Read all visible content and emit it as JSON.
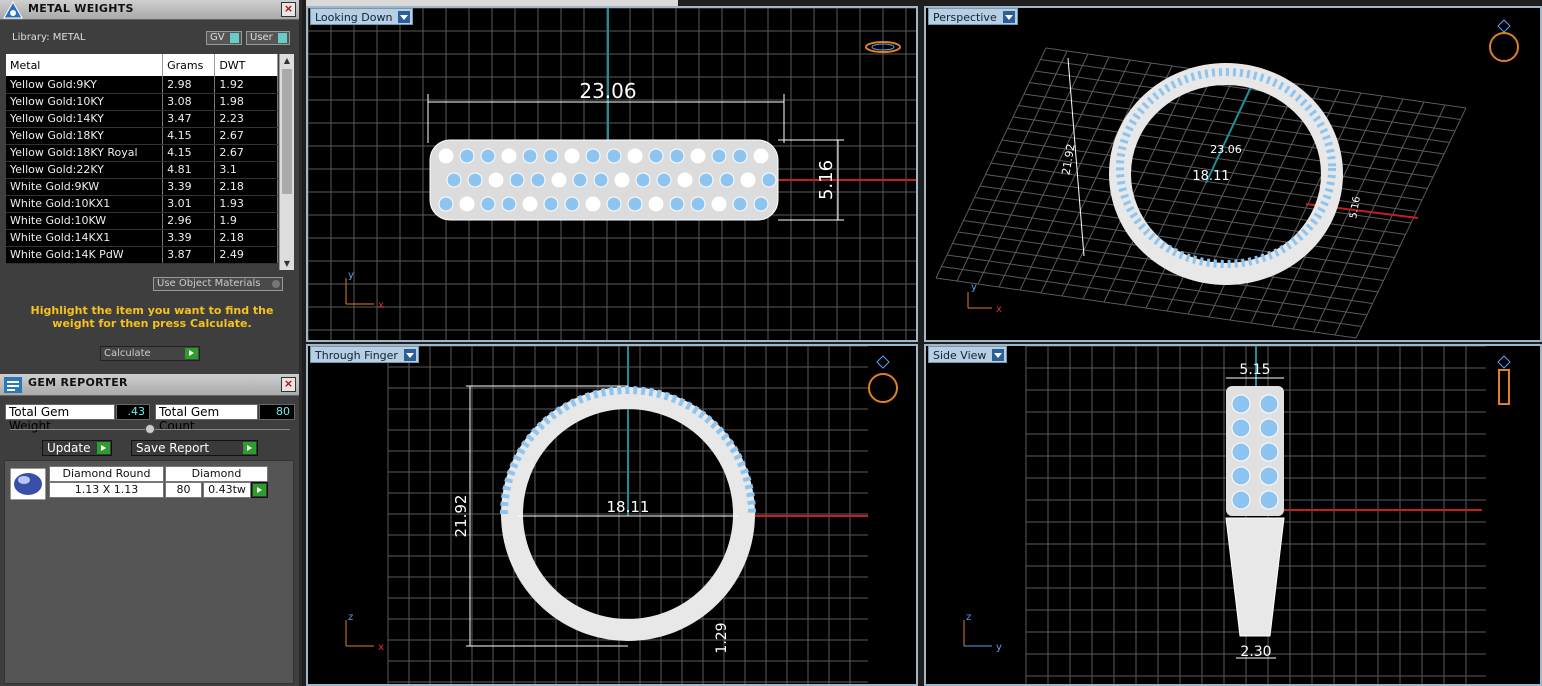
{
  "metal_panel": {
    "title": "METAL WEIGHTS",
    "library_label": "Library: METAL",
    "gv_label": "GV",
    "user_label": "User",
    "columns": [
      "Metal",
      "Grams",
      "DWT"
    ],
    "rows": [
      [
        "Yellow Gold:9KY",
        "2.98",
        "1.92"
      ],
      [
        "Yellow Gold:10KY",
        "3.08",
        "1.98"
      ],
      [
        "Yellow Gold:14KY",
        "3.47",
        "2.23"
      ],
      [
        "Yellow Gold:18KY",
        "4.15",
        "2.67"
      ],
      [
        "Yellow Gold:18KY Royal",
        "4.15",
        "2.67"
      ],
      [
        "Yellow Gold:22KY",
        "4.81",
        "3.1"
      ],
      [
        "White Gold:9KW",
        "3.39",
        "2.18"
      ],
      [
        "White Gold:10KX1",
        "3.01",
        "1.93"
      ],
      [
        "White Gold:10KW",
        "2.96",
        "1.9"
      ],
      [
        "White Gold:14KX1",
        "3.39",
        "2.18"
      ],
      [
        "White Gold:14K PdW",
        "3.87",
        "2.49"
      ]
    ],
    "use_object_materials": "Use Object Materials",
    "hint": "Highlight the item you want to find the weight for then press Calculate.",
    "calculate": "Calculate"
  },
  "gem_panel": {
    "title": "GEM REPORTER",
    "total_weight_label": "Total Gem Weight",
    "total_weight": ".43",
    "total_count_label": "Total Gem Count",
    "total_count": "80",
    "update": "Update",
    "save_report": "Save Report",
    "gem": {
      "name": "Diamond Round",
      "type": "Diamond",
      "size": "1.13 X 1.13",
      "count": "80",
      "weight": "0.43tw"
    }
  },
  "viewports": {
    "top": {
      "label": "Looking Down",
      "width_dim": "23.06",
      "height_dim": "5.16"
    },
    "perspective": {
      "label": "Perspective",
      "dim1": "23.06",
      "dim2": "18.11",
      "dim3": "21.92",
      "dim4": "5.16"
    },
    "front": {
      "label": "Through Finger",
      "diameter": "18.11",
      "height": "21.92",
      "thickness": "1.29"
    },
    "side": {
      "label": "Side View",
      "top_width": "5.15",
      "bottom_width": "2.30"
    }
  },
  "axes": {
    "x": "x",
    "y": "y",
    "z": "z"
  },
  "colors": {
    "panel_bg": "#3e3e3e",
    "viewport_bg": "#000000",
    "label_bg": "#b7cfe4",
    "hint": "#f7c21d",
    "accent_green": "#2d9d2d",
    "gem_blue": "#8ec5f0",
    "ring_white": "#e8e8e8",
    "axis_red": "#c02020",
    "axis_teal": "#1f8c9a",
    "icon_orange": "#e08020"
  }
}
